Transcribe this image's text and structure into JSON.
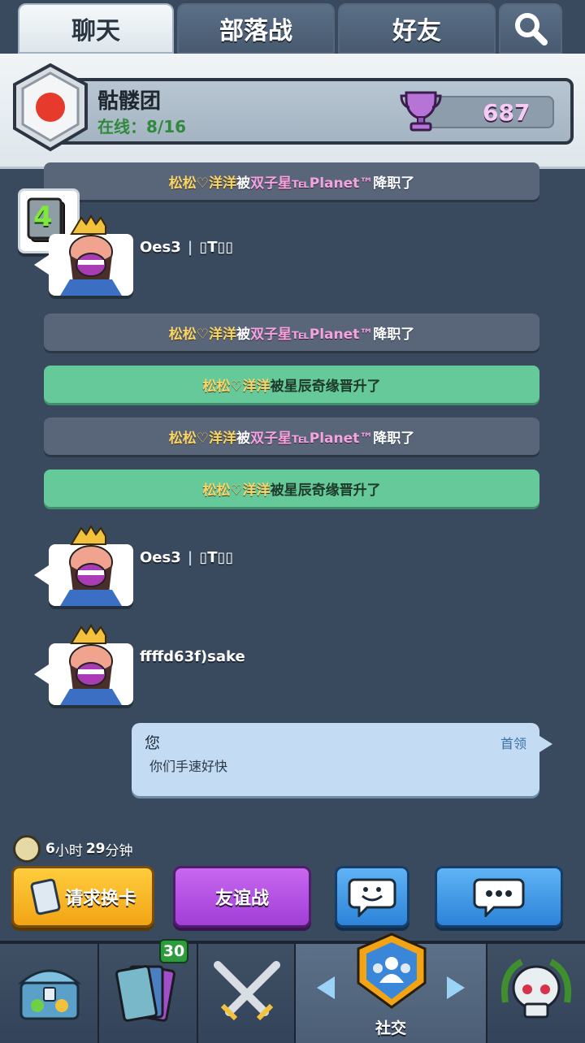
{
  "tabs": [
    {
      "label": "聊天",
      "active": true
    },
    {
      "label": "部落战",
      "active": false
    },
    {
      "label": "好友",
      "active": false
    }
  ],
  "search_icon": "search-icon",
  "clan": {
    "name": "骷髅团",
    "online": "在线：8/16",
    "trophies": "687"
  },
  "level_badge": "4",
  "messages": {
    "m0": {
      "name": "松松♡洋洋",
      "mid": "被",
      "actor": "双子星℡Planet™",
      "verb": "降职了"
    },
    "m1": {
      "name": "松松♡洋洋",
      "mid": "被",
      "actor": "双子星℡Planet™",
      "verb": "降职了"
    },
    "m2": {
      "name": "松松♡洋洋",
      "verb": "被星辰奇缘晋升了"
    },
    "m3": {
      "name": "松松♡洋洋",
      "mid": "被",
      "actor": "双子星℡Planet™",
      "verb": "降职了"
    },
    "m4": {
      "name": "松松♡洋洋",
      "verb": "被星辰奇缘晋升了"
    }
  },
  "users": [
    {
      "name": "Oes3",
      "sep": "|",
      "tag": "▯T▯▯"
    },
    {
      "name": "Oes3",
      "sep": "|",
      "tag": "▯T▯▯"
    },
    {
      "name": "ffffd63f)sake",
      "sep": "",
      "tag": ""
    }
  ],
  "my_message": {
    "name": "您",
    "role": "首领",
    "text": "你们手速好快"
  },
  "timer": {
    "hours": "6",
    "hours_unit": "小时",
    "minutes": "29",
    "minutes_unit": "分钟"
  },
  "buttons": {
    "request": "请求换卡",
    "friendly_battle": "友谊战"
  },
  "nav": {
    "cards_count": "30",
    "social_label": "社交"
  },
  "colors": {
    "background": "#3a4a5e",
    "green_msg": "#65c999",
    "gray_msg": "#59667a",
    "request_btn": "#f2a414",
    "battle_btn": "#a13fd7",
    "blue_btn": "#2d83d8"
  }
}
